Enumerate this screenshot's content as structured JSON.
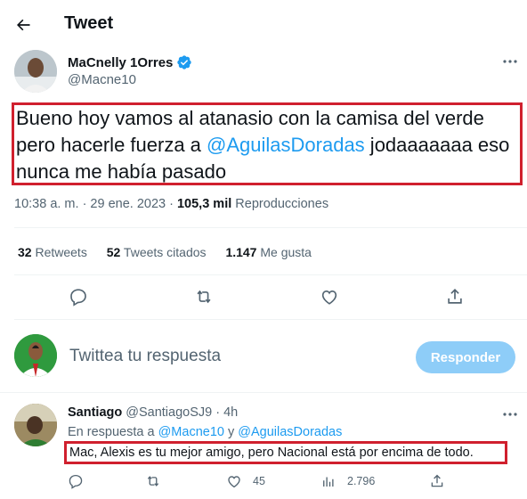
{
  "header": {
    "title": "Tweet",
    "back_icon": "arrow-left-icon"
  },
  "tweet": {
    "author_name": "MaCnelly 1Orres",
    "author_handle": "@Macne10",
    "text_part1": "Bueno hoy vamos al atanasio con la camisa del verde pero hacerle fuerza a ",
    "text_mention": "@AguilasDoradas",
    "text_part2": " jodaaaaaaa eso nunca me había pasado",
    "timestamp": "10:38 a. m. · 29 ene. 2023 · ",
    "views_count": "105,3 mil",
    "views_label": " Reproducciones"
  },
  "stats": {
    "retweets_count": "32",
    "retweets_label": " Retweets",
    "quotes_count": "52",
    "quotes_label": " Tweets citados",
    "likes_count": "1.147",
    "likes_label": " Me gusta"
  },
  "compose": {
    "placeholder": "Twittea tu respuesta",
    "button_label": "Responder"
  },
  "reply": {
    "name": "Santiago",
    "handle_time": " @SantiagoSJ9 · 4h",
    "replying_prefix": "En respuesta a ",
    "replying_mention1": "@Macne10",
    "replying_sep": " y ",
    "replying_mention2": "@AguilasDoradas",
    "text": "Mac, Alexis es tu mejor amigo, pero Nacional está por encima de todo.",
    "likes": "45",
    "views": "2.796"
  },
  "colors": {
    "accent": "#1d9bf0",
    "highlight_box": "#d0202e",
    "muted": "#536471"
  }
}
